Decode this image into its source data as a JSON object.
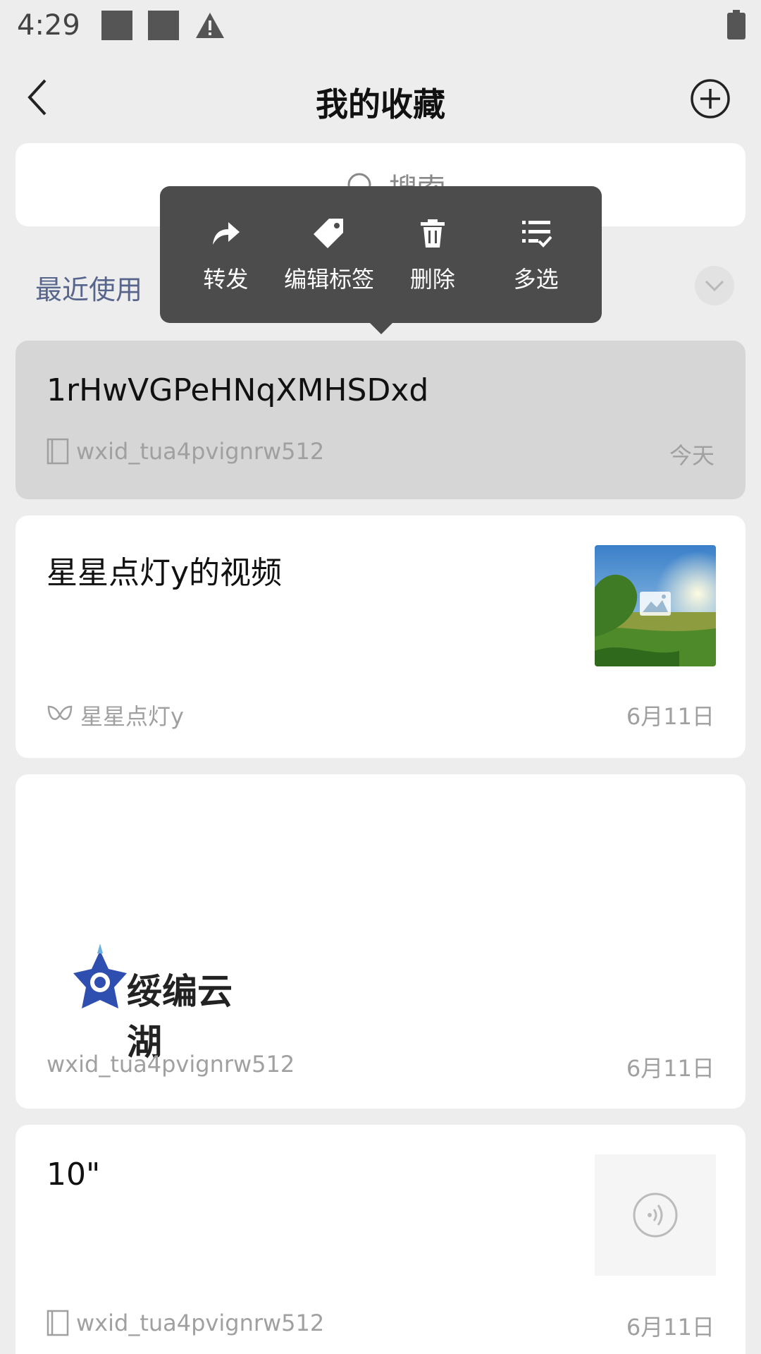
{
  "status_bar": {
    "time": "4:29"
  },
  "app_bar": {
    "title": "我的收藏"
  },
  "search": {
    "placeholder": "搜索"
  },
  "recent": {
    "label": "最近使用"
  },
  "popup_menu": {
    "items": [
      {
        "label": "转发",
        "icon": "share-icon"
      },
      {
        "label": "编辑标签",
        "icon": "tag-icon"
      },
      {
        "label": "删除",
        "icon": "trash-icon"
      },
      {
        "label": "多选",
        "icon": "multi-select-icon"
      }
    ]
  },
  "favorites": [
    {
      "title": "1rHwVGPeHNqXMHSDxd",
      "source": "wxid_tua4pvignrw512",
      "date": "今天",
      "source_icon": "note-icon",
      "selected": true
    },
    {
      "title": "星星点灯y的视频",
      "source": "星星点灯y",
      "date": "6月11日",
      "source_icon": "channels-icon",
      "thumbnail": "landscape-image"
    },
    {
      "source": "wxid_tua4pvignrw512",
      "date": "6月11日",
      "image_text": "绥编云湖"
    },
    {
      "title": "10\"",
      "source": "wxid_tua4pvignrw512",
      "date": "6月11日",
      "source_icon": "note-icon",
      "thumbnail": "voice-icon"
    }
  ],
  "colors": {
    "background": "#ededed",
    "popup": "#4c4c4c",
    "recent_label": "#57648c",
    "selected_card": "#d6d6d6"
  }
}
